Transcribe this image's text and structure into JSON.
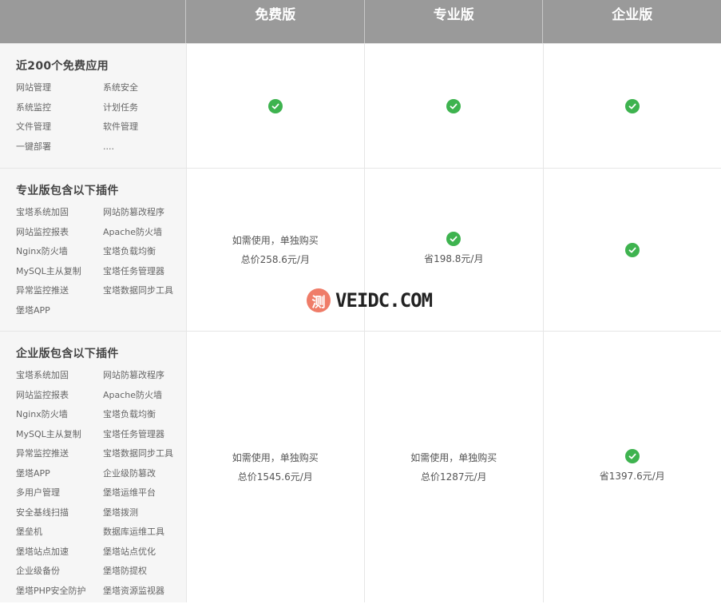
{
  "header": {
    "plans": [
      "免费版",
      "专业版",
      "企业版"
    ]
  },
  "rows": [
    {
      "title": "近200个免费应用",
      "items": [
        "网站管理",
        "系统安全",
        "系统监控",
        "计划任务",
        "文件管理",
        "软件管理",
        "一键部署",
        "...."
      ],
      "free": {
        "check": true,
        "lines": []
      },
      "pro": {
        "check": true,
        "lines": []
      },
      "ent": {
        "check": true,
        "lines": []
      }
    },
    {
      "title": "专业版包含以下插件",
      "items": [
        "宝塔系统加固",
        "网站防篡改程序",
        "网站监控报表",
        "Apache防火墙",
        "Nginx防火墙",
        "宝塔负载均衡",
        "MySQL主从复制",
        "宝塔任务管理器",
        "异常监控推送",
        "宝塔数据同步工具",
        "堡塔APP",
        ""
      ],
      "free": {
        "check": false,
        "lines": [
          "如需使用，单独购买",
          "总价258.6元/月"
        ]
      },
      "pro": {
        "check": true,
        "lines": [
          "省198.8元/月"
        ]
      },
      "ent": {
        "check": true,
        "lines": []
      }
    },
    {
      "title": "企业版包含以下插件",
      "items": [
        "宝塔系统加固",
        "网站防篡改程序",
        "网站监控报表",
        "Apache防火墙",
        "Nginx防火墙",
        "宝塔负载均衡",
        "MySQL主从复制",
        "宝塔任务管理器",
        "异常监控推送",
        "宝塔数据同步工具",
        "堡塔APP",
        "企业级防篡改",
        "多用户管理",
        "堡塔运维平台",
        "安全基线扫描",
        "堡塔拨测",
        "堡垒机",
        "数据库运维工具",
        "堡塔站点加速",
        "堡塔站点优化",
        "企业级备份",
        "堡塔防提权",
        "堡塔PHP安全防护",
        "堡塔资源监视器"
      ],
      "free": {
        "check": false,
        "lines": [
          "如需使用，单独购买",
          "总价1545.6元/月"
        ]
      },
      "pro": {
        "check": false,
        "lines": [
          "如需使用，单独购买",
          "总价1287元/月"
        ]
      },
      "ent": {
        "check": true,
        "lines": [
          "省1397.6元/月"
        ]
      }
    }
  ],
  "watermark": {
    "badge": "测",
    "text": "VEIDC.COM"
  },
  "colors": {
    "header_bg": "#9a9a9a",
    "check_green": "#3eb34f",
    "feature_bg": "#f6f6f6",
    "watermark_badge": "#ef7c68"
  }
}
